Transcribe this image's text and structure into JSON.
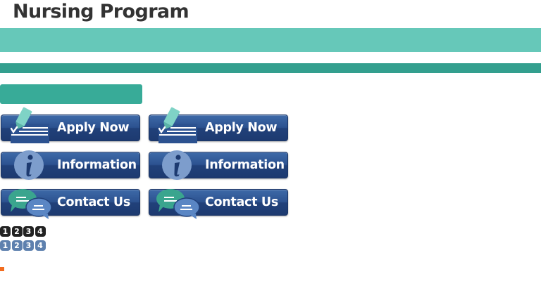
{
  "page": {
    "title": "Nursing Program"
  },
  "buttons": {
    "apply_label": "Apply Now",
    "info_label": "Information",
    "contact_label": "Contact Us"
  },
  "pagination": {
    "dark": [
      "1",
      "2",
      "3",
      "4"
    ],
    "blue": [
      "1",
      "2",
      "3",
      "4"
    ]
  },
  "icons": {
    "apply": "pencil-document-icon",
    "info": "info-icon",
    "contact": "chat-bubbles-icon"
  },
  "colors": {
    "band_light": "#66c8b9",
    "band_dark": "#339f8e",
    "button_blue": "#2c5290",
    "accent_orange": "#f26c1f"
  }
}
